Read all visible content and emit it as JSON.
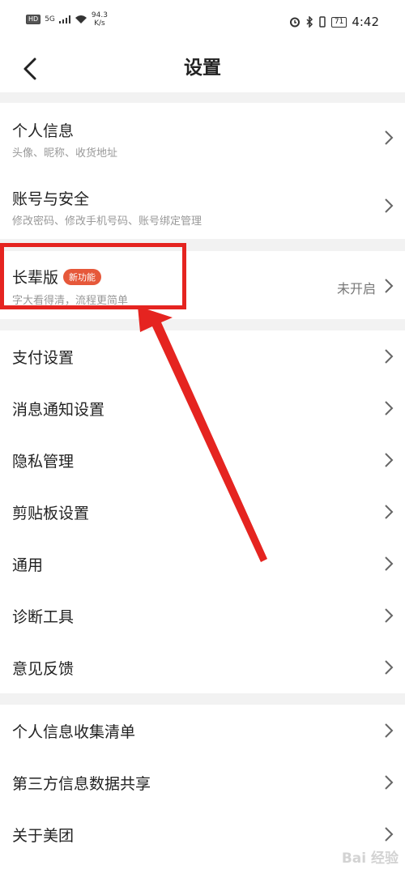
{
  "status": {
    "left_hd": "HD",
    "left_net": "5G",
    "speed_value": "94.3",
    "speed_unit": "K/s",
    "battery": "71",
    "time": "4:42"
  },
  "nav": {
    "title": "设置"
  },
  "group1": [
    {
      "title": "个人信息",
      "subtitle": "头像、昵称、收货地址"
    },
    {
      "title": "账号与安全",
      "subtitle": "修改密码、修改手机号码、账号绑定管理"
    }
  ],
  "elder": {
    "title": "长辈版",
    "badge": "新功能",
    "subtitle": "字大看得清，流程更简单",
    "value": "未开启"
  },
  "group3": [
    "支付设置",
    "消息通知设置",
    "隐私管理",
    "剪贴板设置",
    "通用",
    "诊断工具",
    "意见反馈"
  ],
  "group4": [
    "个人信息收集清单",
    "第三方信息数据共享",
    "关于美团"
  ],
  "watermark": "Bai 经验"
}
